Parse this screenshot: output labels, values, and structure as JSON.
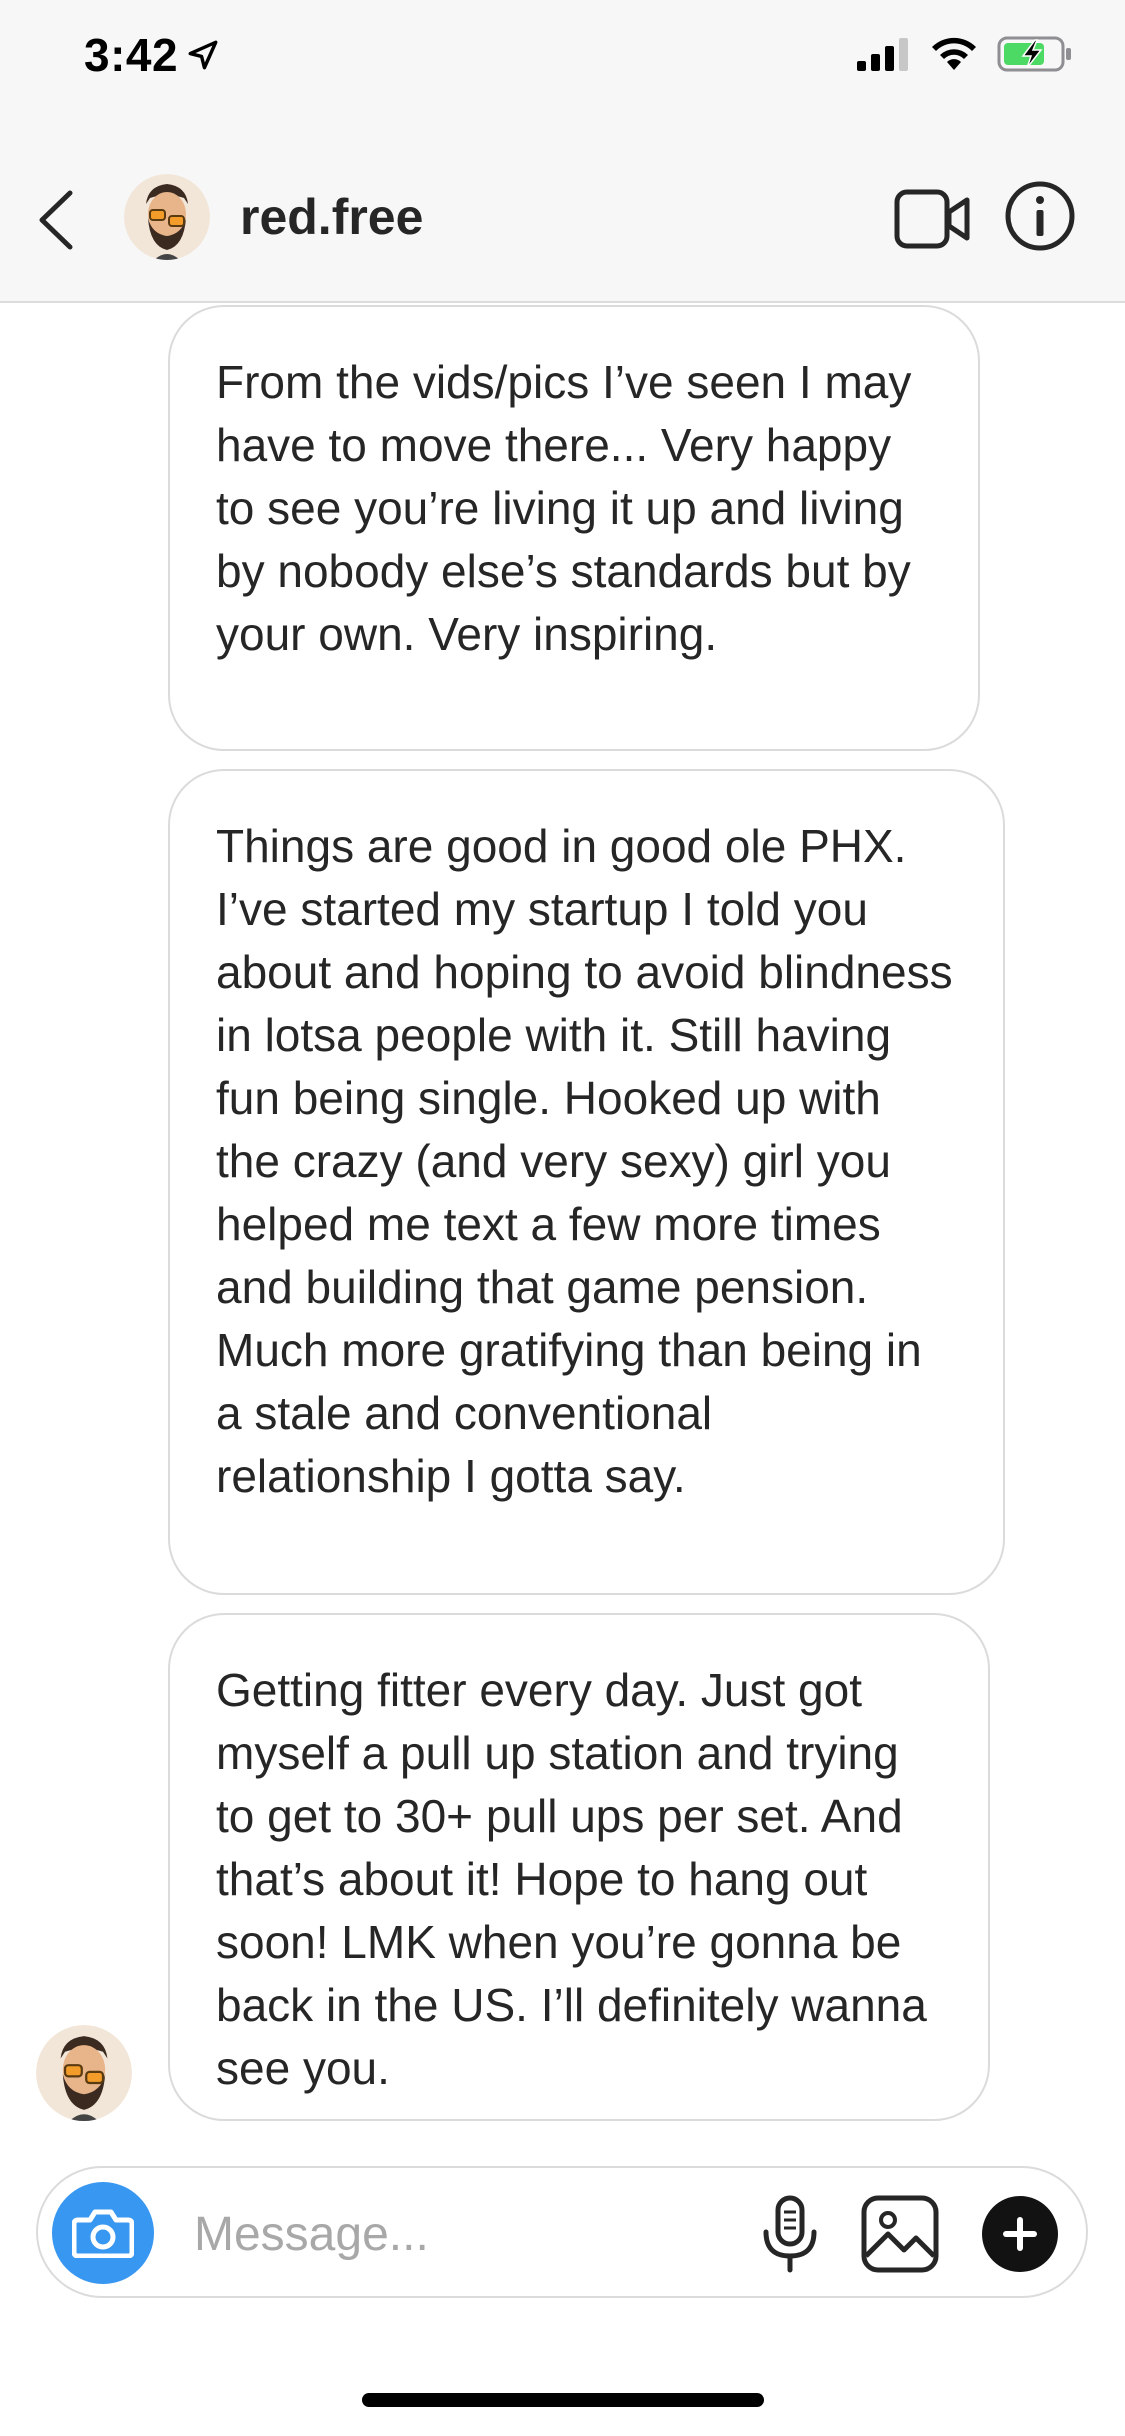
{
  "status_bar": {
    "time": "3:42",
    "icons": [
      "location-arrow-icon",
      "signal-icon",
      "wifi-icon",
      "battery-charging-icon"
    ],
    "battery_color": "#4cd964"
  },
  "header": {
    "username": "red.free",
    "icons": [
      "back-chevron-icon",
      "avatar",
      "video-call-icon",
      "info-icon"
    ]
  },
  "messages": [
    {
      "sender": "red.free",
      "text": "From the vids/pics I’ve seen I may have to move there... Very happy to see you’re living it up and living by nobody else’s standards but by your own. Very inspiring."
    },
    {
      "sender": "red.free",
      "text": "Things are good in good ole PHX. I’ve started my startup I told you about and hoping to avoid blindness in lotsa people with it. Still having fun being single. Hooked up with the crazy (and very sexy) girl you helped me text a few more times and building that game pension. Much more gratifying than being in a stale and conventional relationship I gotta say."
    },
    {
      "sender": "red.free",
      "text": "Getting fitter every day. Just got myself a pull up station and trying to get to 30+ pull ups per set. And that’s about it! Hope to hang out soon! LMK when you’re gonna be back in the US. I’ll definitely wanna see you."
    }
  ],
  "composer": {
    "placeholder": "Message...",
    "value": "",
    "icons": [
      "camera-icon",
      "microphone-icon",
      "gallery-icon",
      "plus-icon"
    ],
    "camera_color": "#3897f0"
  }
}
